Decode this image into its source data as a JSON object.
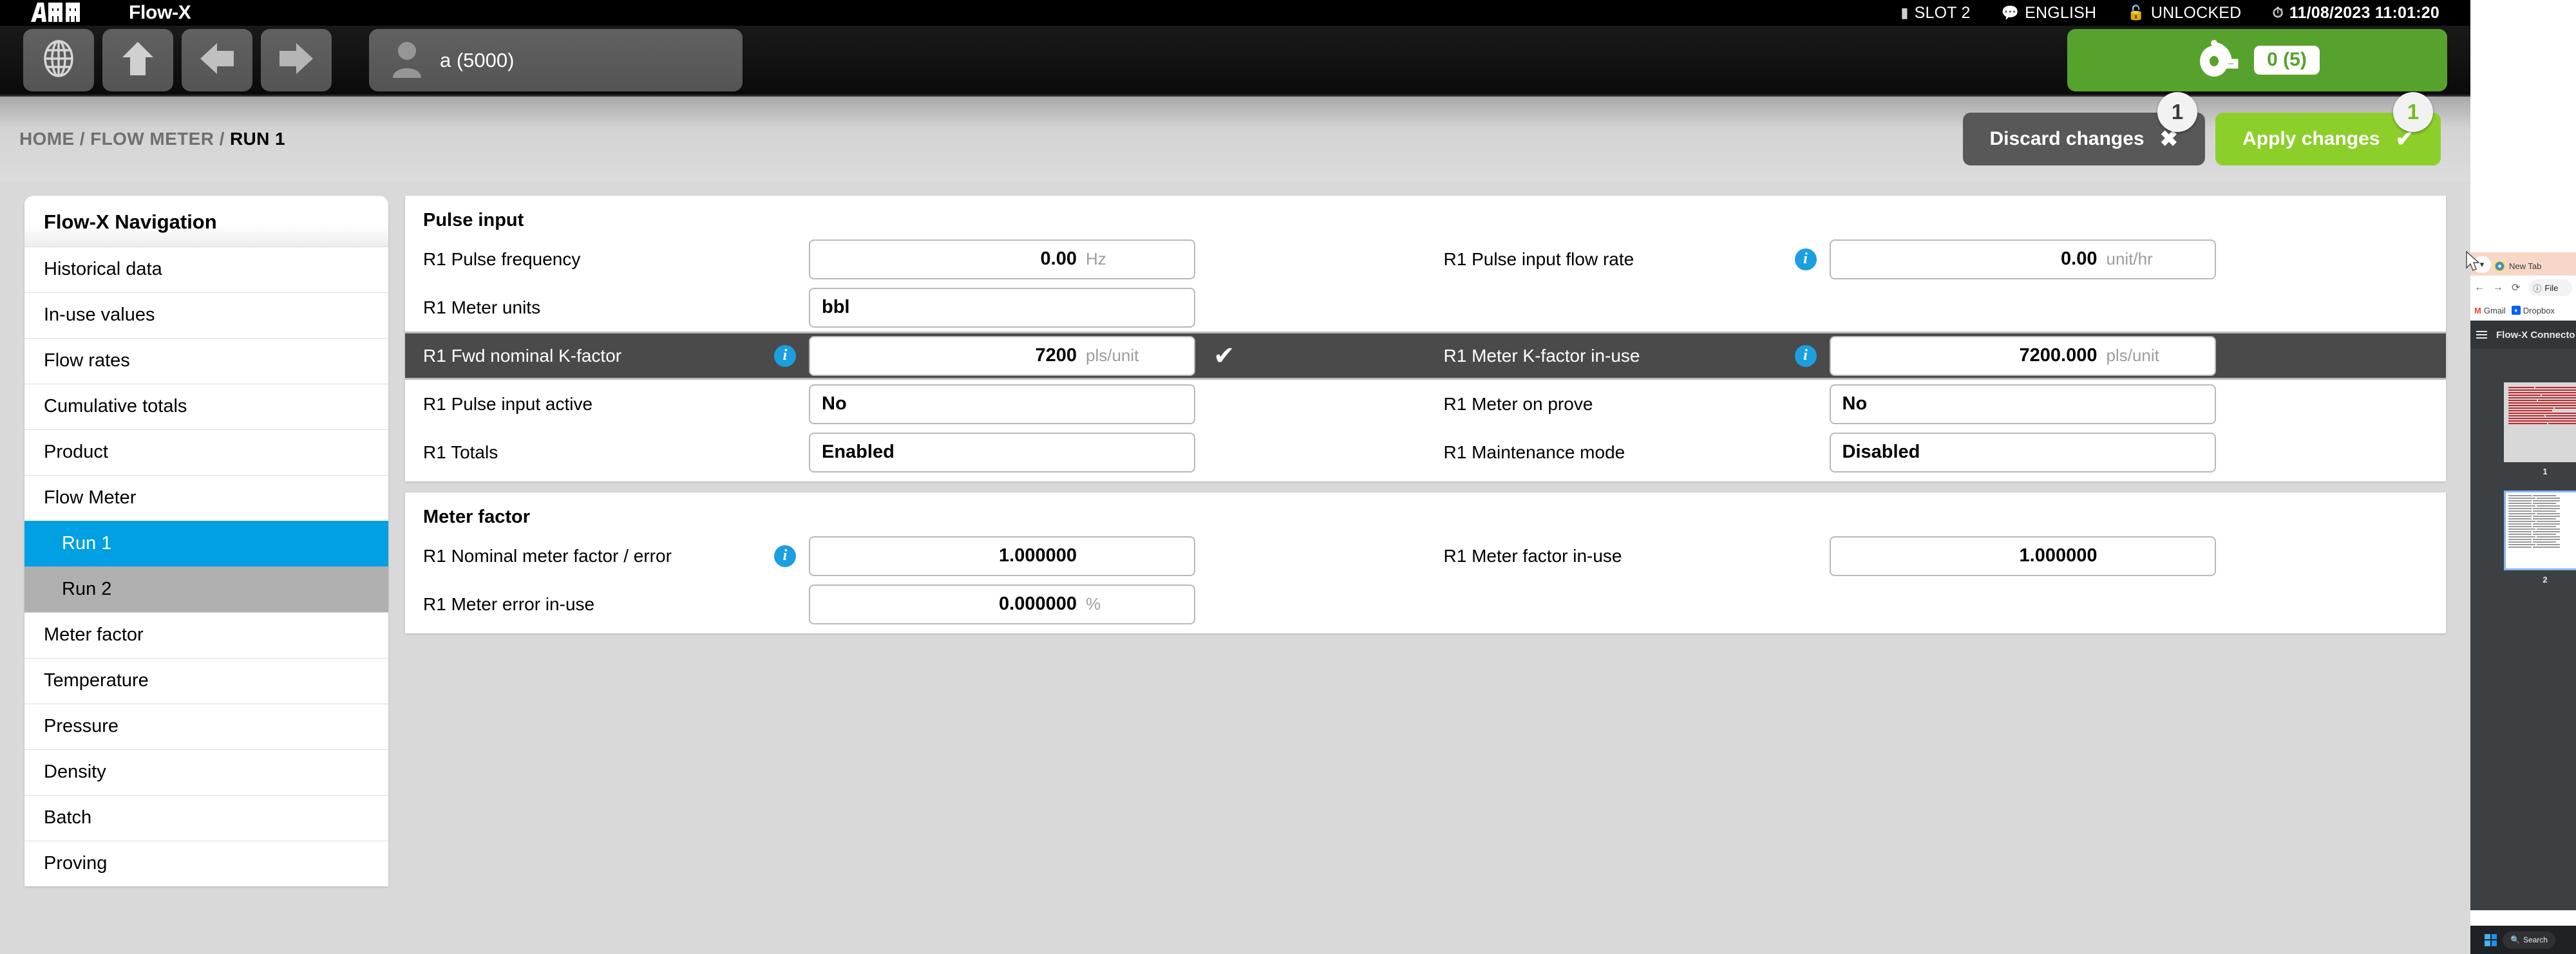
{
  "titlebar": {
    "brand": "ABB",
    "app_title": "Flow-X",
    "status": [
      {
        "icon": "slot-icon",
        "label": "SLOT 2"
      },
      {
        "icon": "language-icon",
        "label": "ENGLISH"
      },
      {
        "icon": "lock-open-icon",
        "label": "UNLOCKED"
      },
      {
        "icon": "clock-icon",
        "label": "11/08/2023 11:01:20"
      }
    ]
  },
  "toolbar": {
    "buttons": [
      {
        "name": "globe-button",
        "icon": "globe-icon"
      },
      {
        "name": "up-button",
        "icon": "arrow-up-icon"
      },
      {
        "name": "back-button",
        "icon": "arrow-left-icon"
      },
      {
        "name": "forward-button",
        "icon": "arrow-right-icon"
      }
    ],
    "user": {
      "icon": "user-icon",
      "label": "a (5000)"
    },
    "prove": {
      "icon": "prover-icon",
      "badge": "0 (5)"
    }
  },
  "subheader": {
    "breadcrumb": {
      "home": "HOME",
      "sep1": "/",
      "section": "FLOW METER",
      "sep2": "/",
      "current": "RUN 1"
    },
    "discard": {
      "label": "Discard changes",
      "mark": "✖",
      "badge": "1"
    },
    "apply": {
      "label": "Apply changes",
      "mark": "✔",
      "badge": "1"
    }
  },
  "sidebar": {
    "title": "Flow-X Navigation",
    "items": [
      {
        "label": "Historical data",
        "state": "normal",
        "sub": false
      },
      {
        "label": "In-use values",
        "state": "normal",
        "sub": false
      },
      {
        "label": "Flow rates",
        "state": "normal",
        "sub": false
      },
      {
        "label": "Cumulative totals",
        "state": "normal",
        "sub": false
      },
      {
        "label": "Product",
        "state": "normal",
        "sub": false
      },
      {
        "label": "Flow Meter",
        "state": "normal",
        "sub": false
      },
      {
        "label": "Run 1",
        "state": "active",
        "sub": true
      },
      {
        "label": "Run 2",
        "state": "hover",
        "sub": true
      },
      {
        "label": "Meter factor",
        "state": "normal",
        "sub": false
      },
      {
        "label": "Temperature",
        "state": "normal",
        "sub": false
      },
      {
        "label": "Pressure",
        "state": "normal",
        "sub": false
      },
      {
        "label": "Density",
        "state": "normal",
        "sub": false
      },
      {
        "label": "Batch",
        "state": "normal",
        "sub": false
      },
      {
        "label": "Proving",
        "state": "normal",
        "sub": false
      }
    ]
  },
  "panels": [
    {
      "title": "Pulse input",
      "rows": [
        {
          "highlight": false,
          "left": {
            "label": "R1 Pulse frequency",
            "info": false,
            "value": "0.00",
            "unit": "Hz",
            "align": "num"
          },
          "right": {
            "label": "R1 Pulse input flow rate",
            "info": true,
            "value": "0.00",
            "unit": "unit/hr",
            "align": "num"
          }
        },
        {
          "highlight": false,
          "left": {
            "label": "R1 Meter units",
            "info": false,
            "value": "bbl",
            "unit": "",
            "align": "text"
          },
          "right": null
        },
        {
          "highlight": true,
          "left": {
            "label": "R1 Fwd nominal K-factor",
            "info": true,
            "value": "7200",
            "unit": "pls/unit",
            "align": "num",
            "check": "✔"
          },
          "right": {
            "label": "R1 Meter K-factor in-use",
            "info": true,
            "value": "7200.000",
            "unit": "pls/unit",
            "align": "num"
          }
        },
        {
          "highlight": false,
          "left": {
            "label": "R1 Pulse input active",
            "info": false,
            "value": "No",
            "unit": "",
            "align": "text"
          },
          "right": {
            "label": "R1 Meter on prove",
            "info": false,
            "value": "No",
            "unit": "",
            "align": "text"
          }
        },
        {
          "highlight": false,
          "left": {
            "label": "R1 Totals",
            "info": false,
            "value": "Enabled",
            "unit": "",
            "align": "text"
          },
          "right": {
            "label": "R1 Maintenance mode",
            "info": false,
            "value": "Disabled",
            "unit": "",
            "align": "text"
          }
        }
      ]
    },
    {
      "title": "Meter factor",
      "rows": [
        {
          "highlight": false,
          "left": {
            "label": "R1 Nominal meter factor / error",
            "info": true,
            "value": "1.000000",
            "unit": "",
            "align": "num"
          },
          "right": {
            "label": "R1 Meter factor in-use",
            "info": false,
            "value": "1.000000",
            "unit": "",
            "align": "num"
          }
        },
        {
          "highlight": false,
          "left": {
            "label": "R1 Meter error in-use",
            "info": false,
            "value": "0.000000",
            "unit": "%",
            "align": "num"
          },
          "right": null
        }
      ]
    }
  ],
  "background_browser": {
    "tab_label": "New Tab",
    "url_label": "File",
    "bookmarks": [
      "Gmail",
      "Dropbox"
    ],
    "pdf_title": "Flow-X Connecto",
    "pages": [
      "1",
      "2"
    ]
  },
  "taskbar": {
    "start": "start-icon",
    "search_label": "Search"
  },
  "colors": {
    "accent_blue": "#00a0e3",
    "apply_green": "#8ccf2a",
    "prove_green": "#57a22d",
    "info_blue": "#1b9fe0",
    "highlight_row": "#4a4a4a"
  }
}
